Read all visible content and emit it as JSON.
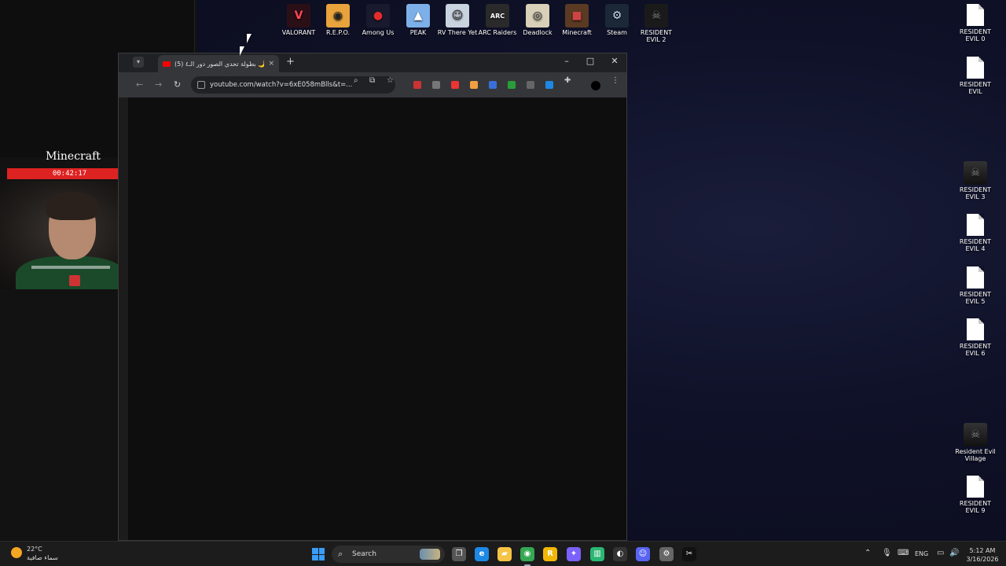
{
  "stream_overlay": {
    "game": "Minecraft",
    "timer": "00:42:17"
  },
  "desktop_top": [
    {
      "label": "VALORANT",
      "color": "#2b0f17",
      "glyph": "V",
      "glyph_color": "#ff4655"
    },
    {
      "label": "R.E.P.O.",
      "color": "#e8a33c",
      "glyph": "◉",
      "glyph_color": "#222"
    },
    {
      "label": "Among Us",
      "color": "#1a1a2e",
      "glyph": "●",
      "glyph_color": "#e52c2c"
    },
    {
      "label": "PEAK",
      "color": "#7db0e8",
      "glyph": "▲",
      "glyph_color": "#fff"
    },
    {
      "label": "RV There Yet",
      "color": "#c9d3e0",
      "glyph": "☺",
      "glyph_color": "#333"
    },
    {
      "label": "ARC Raiders",
      "color": "#2a2a2a",
      "glyph": "ARC",
      "glyph_color": "#fff"
    },
    {
      "label": "Deadlock",
      "color": "#d8d0b8",
      "glyph": "◎",
      "glyph_color": "#333"
    },
    {
      "label": "Minecraft",
      "color": "#5a3a22",
      "glyph": "■",
      "glyph_color": "#c44"
    },
    {
      "label": "Steam",
      "color": "#1b2838",
      "glyph": "⚙",
      "glyph_color": "#cde"
    },
    {
      "label": "RESIDENT EVIL 2",
      "color": "#1a1a1a",
      "glyph": "☠",
      "glyph_color": "#888"
    }
  ],
  "desktop_right": [
    {
      "label": "RESIDENT EVIL 0",
      "type": "file"
    },
    {
      "label": "RESIDENT EVIL",
      "type": "file"
    },
    {
      "label": "RESIDENT EVIL 3",
      "type": "image"
    },
    {
      "label": "RESIDENT EVIL 4",
      "type": "file"
    },
    {
      "label": "RESIDENT EVIL 5",
      "type": "file"
    },
    {
      "label": "RESIDENT EVIL 6",
      "type": "file"
    },
    {
      "label": "Resident Evil Village",
      "type": "image"
    },
    {
      "label": "RESIDENT EVIL 9",
      "type": "file"
    }
  ],
  "browser": {
    "tab_title": "(5) بطولة تحدي الصور دور الـ٤ 🌙",
    "new_tab": "+",
    "tab_close": "×",
    "url": "youtube.com/watch?v=6xE058mBlls&t=...",
    "minimize": "–",
    "maximize": "□",
    "close": "✕",
    "back": "←",
    "forward": "→",
    "reload": "↻",
    "extensions": [
      "#c33",
      "#777",
      "#e33",
      "#f0a040",
      "#3a6fd8",
      "#2a9d3a",
      "#666",
      "#1e88e5"
    ]
  },
  "taskbar": {
    "weather_temp": "22°C",
    "weather_desc": "سماء صافية",
    "search_label": "Search",
    "lang": "ENG",
    "time": "5:12 AM",
    "date": "3/16/2026",
    "apps": [
      {
        "name": "file-explorer",
        "color": "#f3c33c",
        "glyph": "▬"
      },
      {
        "name": "task-view",
        "color": "#555",
        "glyph": "❐"
      },
      {
        "name": "edge",
        "color": "#1e88e5",
        "glyph": "e"
      },
      {
        "name": "folder",
        "color": "#f6c445",
        "glyph": "▰"
      },
      {
        "name": "chrome",
        "color": "#34a853",
        "glyph": "◉"
      },
      {
        "name": "rockstar",
        "color": "#f2b705",
        "glyph": "R"
      },
      {
        "name": "copilot",
        "color": "#7b61ff",
        "glyph": "✦"
      },
      {
        "name": "audio-app",
        "color": "#2bb673",
        "glyph": "▥"
      },
      {
        "name": "obs",
        "color": "#333",
        "glyph": "◐"
      },
      {
        "name": "discord",
        "color": "#5865f2",
        "glyph": "☺"
      },
      {
        "name": "settings",
        "color": "#666",
        "glyph": "⚙"
      },
      {
        "name": "capcut",
        "color": "#111",
        "glyph": "✂"
      }
    ]
  }
}
